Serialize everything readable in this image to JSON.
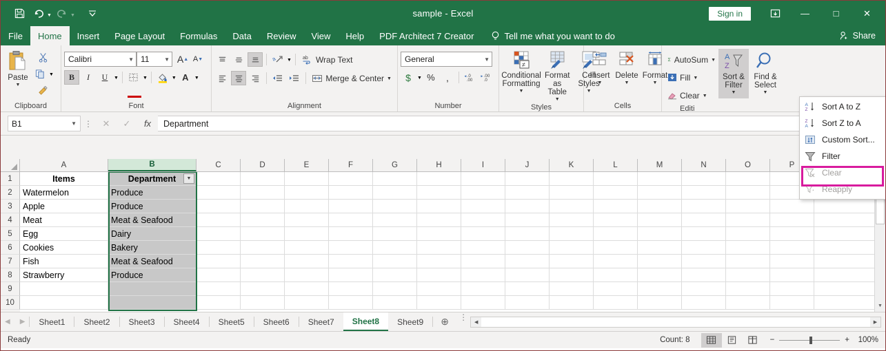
{
  "titlebar": {
    "document_title": "sample  -  Excel",
    "quick_access": [
      {
        "name": "save",
        "icon": "save-icon"
      },
      {
        "name": "undo",
        "icon": "undo-icon"
      },
      {
        "name": "redo",
        "icon": "redo-icon"
      },
      {
        "name": "customize",
        "icon": "chevron-down-icon"
      }
    ],
    "sign_in": "Sign in",
    "ribbon_display_options": "ribbon-display-icon",
    "minimize": "—",
    "maximize": "□",
    "close": "✕"
  },
  "ribbon_tabs": [
    {
      "label": "File",
      "active": false
    },
    {
      "label": "Home",
      "active": true
    },
    {
      "label": "Insert",
      "active": false
    },
    {
      "label": "Page Layout",
      "active": false
    },
    {
      "label": "Formulas",
      "active": false
    },
    {
      "label": "Data",
      "active": false
    },
    {
      "label": "Review",
      "active": false
    },
    {
      "label": "View",
      "active": false
    },
    {
      "label": "Help",
      "active": false
    },
    {
      "label": "PDF Architect 7 Creator",
      "active": false
    }
  ],
  "tell_me": "Tell me what you want to do",
  "share": "Share",
  "ribbon": {
    "clipboard": {
      "label": "Clipboard",
      "paste": "Paste",
      "cut": "cut-icon",
      "copy": "copy-icon",
      "format_painter": "format-painter-icon"
    },
    "font": {
      "label": "Font",
      "font_name": "Calibri",
      "font_size": "11",
      "grow_font": "A",
      "shrink_font": "A",
      "bold": "B",
      "italic": "I",
      "underline": "U",
      "borders": "borders-icon",
      "fill_color": "fill-color-icon",
      "font_color": "A"
    },
    "alignment": {
      "label": "Alignment",
      "align_top": "align-top-icon",
      "align_middle": "align-middle-icon",
      "align_bottom": "align-bottom-icon",
      "orientation": "orientation-icon",
      "align_left": "align-left-icon",
      "align_center": "align-center-icon",
      "align_right": "align-right-icon",
      "decrease_indent": "decrease-indent-icon",
      "increase_indent": "increase-indent-icon",
      "wrap_text": "Wrap Text",
      "merge_center": "Merge & Center"
    },
    "number": {
      "label": "Number",
      "format": "General",
      "accounting": "$",
      "percent": "%",
      "comma": ",",
      "increase_decimal": "increase-decimal-icon",
      "decrease_decimal": "decrease-decimal-icon"
    },
    "styles": {
      "label": "Styles",
      "conditional_formatting_l1": "Conditional",
      "conditional_formatting_l2": "Formatting",
      "format_as_table_l1": "Format as",
      "format_as_table_l2": "Table",
      "cell_styles_l1": "Cell",
      "cell_styles_l2": "Styles"
    },
    "cells": {
      "label": "Cells",
      "insert": "Insert",
      "delete": "Delete",
      "format": "Format"
    },
    "editing": {
      "label": "Editi",
      "autosum": "AutoSum",
      "fill": "Fill",
      "clear": "Clear",
      "sort_filter_l1": "Sort &",
      "sort_filter_l2": "Filter",
      "find_select_l1": "Find &",
      "find_select_l2": "Select"
    }
  },
  "sort_filter_menu": {
    "items": [
      {
        "label": "Sort A to Z",
        "icon": "sort-az-icon",
        "disabled": false,
        "highlighted": false
      },
      {
        "label": "Sort Z to A",
        "icon": "sort-za-icon",
        "disabled": false,
        "highlighted": false
      },
      {
        "label": "Custom Sort...",
        "icon": "custom-sort-icon",
        "disabled": false,
        "highlighted": false
      },
      {
        "label": "Filter",
        "icon": "filter-icon",
        "disabled": false,
        "highlighted": true
      },
      {
        "label": "Clear",
        "icon": "clear-filter-icon",
        "disabled": true,
        "highlighted": false
      },
      {
        "label": "Reapply",
        "icon": "reapply-filter-icon",
        "disabled": true,
        "highlighted": false
      }
    ],
    "highlight_color": "#d81b9e"
  },
  "formula_bar": {
    "name_box": "B1",
    "cancel": "✕",
    "enter": "✓",
    "insert_function": "fx",
    "content": "Department"
  },
  "grid": {
    "columns": [
      "A",
      "B",
      "C",
      "D",
      "E",
      "F",
      "G",
      "H",
      "I",
      "J",
      "K",
      "L",
      "M",
      "N",
      "O",
      "P"
    ],
    "selected_column": "B",
    "rows": [
      "1",
      "2",
      "3",
      "4",
      "5",
      "6",
      "7",
      "8",
      "9",
      "10"
    ],
    "headers": {
      "A": "Items",
      "B": "Department"
    },
    "data": [
      {
        "row": "2",
        "A": "Watermelon",
        "B": "Produce"
      },
      {
        "row": "3",
        "A": "Apple",
        "B": "Produce"
      },
      {
        "row": "4",
        "A": "Meat",
        "B": "Meat & Seafood"
      },
      {
        "row": "5",
        "A": "Egg",
        "B": "Dairy"
      },
      {
        "row": "6",
        "A": "Cookies",
        "B": "Bakery"
      },
      {
        "row": "7",
        "A": "Fish",
        "B": "Meat & Seafood"
      },
      {
        "row": "8",
        "A": "Strawberry",
        "B": "Produce"
      },
      {
        "row": "9",
        "A": "",
        "B": ""
      },
      {
        "row": "10",
        "A": "",
        "B": ""
      }
    ],
    "filter_button": "filter-dropdown-icon"
  },
  "sheet_tabs": {
    "tabs": [
      {
        "label": "Sheet1",
        "active": false
      },
      {
        "label": "Sheet2",
        "active": false
      },
      {
        "label": "Sheet3",
        "active": false
      },
      {
        "label": "Sheet4",
        "active": false
      },
      {
        "label": "Sheet5",
        "active": false
      },
      {
        "label": "Sheet6",
        "active": false
      },
      {
        "label": "Sheet7",
        "active": false
      },
      {
        "label": "Sheet8",
        "active": true
      },
      {
        "label": "Sheet9",
        "active": false
      }
    ],
    "add_sheet": "⊕",
    "prev": "◀",
    "next": "▶"
  },
  "status_bar": {
    "status": "Ready",
    "count": "Count: 8",
    "views": [
      {
        "name": "normal-view",
        "active": true
      },
      {
        "name": "page-layout-view",
        "active": false
      },
      {
        "name": "page-break-preview",
        "active": false
      }
    ],
    "zoom_out": "−",
    "zoom_in": "+",
    "zoom_level": "100%"
  }
}
